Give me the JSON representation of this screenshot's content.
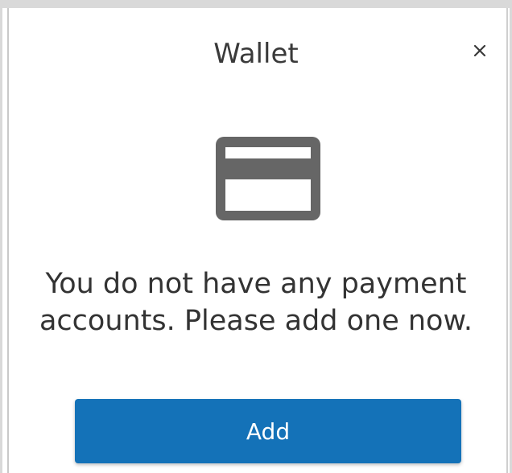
{
  "dialog": {
    "title": "Wallet",
    "close_icon": "close-icon",
    "empty_state_icon": "credit-card-icon",
    "message": "You do not have any payment accounts. Please add one now.",
    "add_label": "Add"
  },
  "colors": {
    "accent": "#1472b8",
    "icon": "#666666",
    "text": "#333333"
  }
}
